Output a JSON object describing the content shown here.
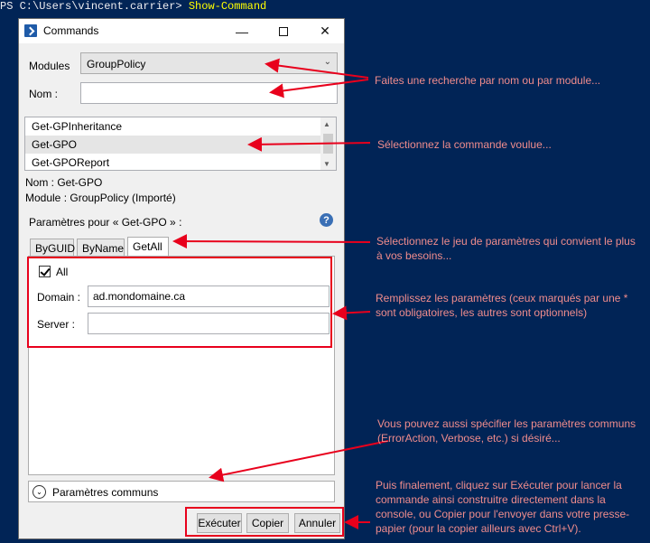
{
  "console": {
    "prompt": "PS C:\\Users\\vincent.carrier> ",
    "command": "Show-Command"
  },
  "window": {
    "title": "Commands",
    "controls": {
      "minimize": "—",
      "close": "✕"
    }
  },
  "form": {
    "modules_label": "Modules",
    "modules_value": "GroupPolicy",
    "name_label": "Nom :",
    "name_value": "",
    "commands": [
      "Get-GPInheritance",
      "Get-GPO",
      "Get-GPOReport"
    ],
    "selected_command_index": 1,
    "info_name": "Nom : Get-GPO",
    "info_module": "Module : GroupPolicy (Importé)",
    "params_for": "Paramètres pour « Get-GPO » :",
    "help_icon": "?",
    "tabs": [
      "ByGUID",
      "ByName",
      "GetAll"
    ],
    "active_tab": "GetAll",
    "all_label": "All",
    "all_checked": true,
    "domain_label": "Domain :",
    "domain_value": "ad.mondomaine.ca",
    "server_label": "Server :",
    "server_value": "",
    "common_params": "Paramètres communs",
    "buttons": {
      "run": "Exécuter",
      "copy": "Copier",
      "cancel": "Annuler"
    }
  },
  "annotations": {
    "search": "Faites une recherche par nom ou par module...",
    "select_cmd": "Sélectionnez la commande voulue...",
    "param_set": "Sélectionnez le jeu de paramètres qui convient le plus à vos besoins...",
    "fill_params": "Remplissez les paramètres (ceux marqués par une * sont obligatoires, les autres sont optionnels)",
    "common_note": "Vous pouvez aussi spécifier les paramètres communs (ErrorAction, Verbose, etc.) si désiré...",
    "finally": "Puis finalement, cliquez sur Exécuter pour lancer la commande ainsi construitre directement dans la console, ou Copier pour l'envoyer dans votre presse-papier (pour la copier ailleurs avec Ctrl+V)."
  },
  "colors": {
    "console_bg": "#012456",
    "annotation": "#f08c8c",
    "highlight": "#e8001c",
    "command": "#ffff00"
  },
  "icons": [
    "powershell-icon",
    "minimize-icon",
    "maximize-icon",
    "close-icon",
    "chevron-down-icon",
    "help-icon",
    "expand-icon",
    "check-icon"
  ]
}
